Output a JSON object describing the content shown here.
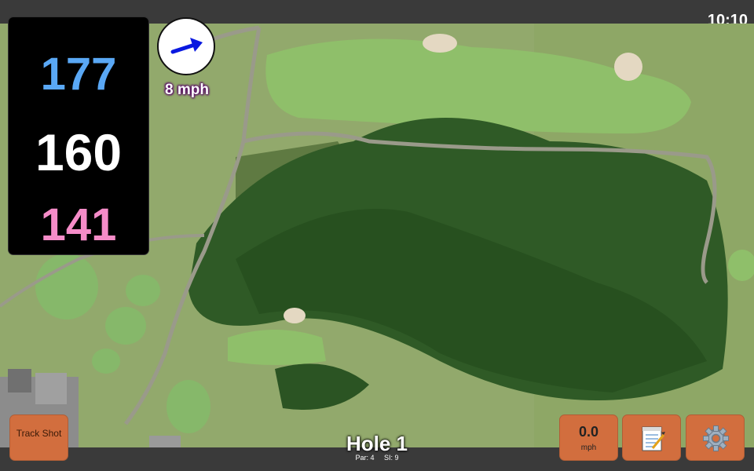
{
  "clock": "10:10",
  "distances": {
    "back": "177",
    "middle": "160",
    "front": "141"
  },
  "wind": {
    "speed_label": "8 mph",
    "icon": "wind-arrow-icon"
  },
  "buttons": {
    "track_shot": "Track Shot",
    "speed_value": "0.0",
    "speed_unit": "mph",
    "notes_icon": "notepad-icon",
    "settings_icon": "gear-icon"
  },
  "hole": {
    "title": "Hole 1",
    "par": "Par: 4",
    "si": "SI: 9"
  },
  "colors": {
    "back": "#5aa8f5",
    "middle": "#ffffff",
    "front": "#f58cc8",
    "button": "#d26e3e",
    "wind_label_outline": "#5a0f66"
  }
}
